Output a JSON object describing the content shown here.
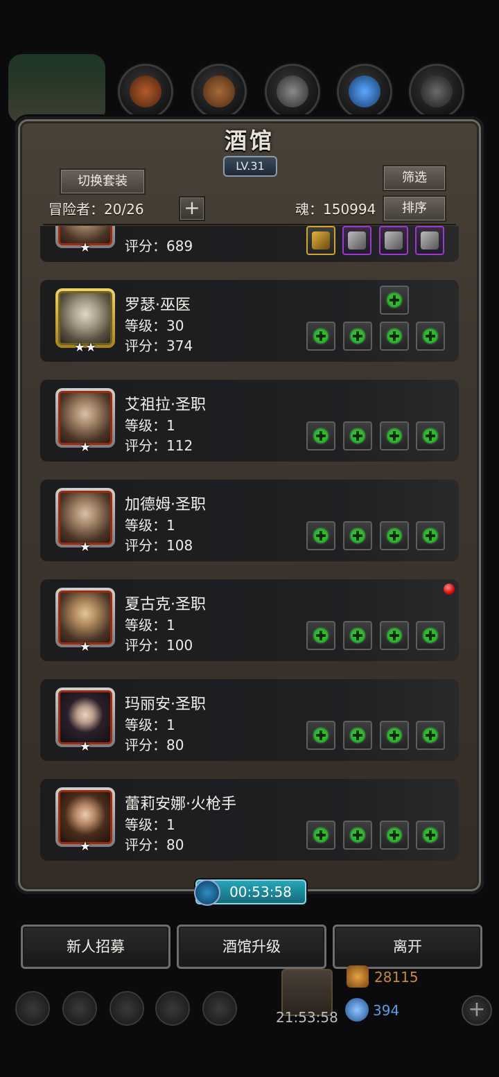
{
  "title": "酒馆",
  "level_badge": "LV.31",
  "buttons": {
    "switch_set": "切换套装",
    "filter": "筛选",
    "sort": "排序"
  },
  "adventurers": {
    "label": "冒险者：20/26"
  },
  "soul": {
    "label": "魂：150994"
  },
  "list": [
    {
      "name": "",
      "level_label": "",
      "score_label": "评分：689",
      "stars": "★",
      "portrait": "orange",
      "equip": [
        "spear-gold",
        "armor-purple",
        "gauntlet-purple",
        "gauntlet-purple"
      ]
    },
    {
      "name": "罗瑟·巫医",
      "level_label": "等级：30",
      "score_label": "评分：374",
      "stars": "★★",
      "portrait": "gold"
    },
    {
      "name": "艾祖拉·圣职",
      "level_label": "等级：1",
      "score_label": "评分：112",
      "stars": "★",
      "portrait": "orange"
    },
    {
      "name": "加德姆·圣职",
      "level_label": "等级：1",
      "score_label": "评分：108",
      "stars": "★",
      "portrait": "orange"
    },
    {
      "name": "夏古克·圣职",
      "level_label": "等级：1",
      "score_label": "评分：100",
      "stars": "★",
      "portrait": "orange"
    },
    {
      "name": "玛丽安·圣职",
      "level_label": "等级：1",
      "score_label": "评分：80",
      "stars": "★",
      "portrait": "orange"
    },
    {
      "name": "蕾莉安娜·火枪手",
      "level_label": "等级：1",
      "score_label": "评分：80",
      "stars": "★",
      "portrait": "orange"
    }
  ],
  "timer": "00:53:58",
  "bottom_buttons": {
    "recruit": "新人招募",
    "upgrade": "酒馆升级",
    "leave": "离开"
  },
  "footer": {
    "gift_timer": "21:53:58",
    "gold": "28115",
    "gems": "394"
  },
  "colors": {
    "accent_green": "#2fbf1e",
    "timer_teal": "#25a6b9",
    "notification_red": "#d40c0c",
    "gold_text": "#c98a2e",
    "gem_text": "#5b9be0"
  }
}
